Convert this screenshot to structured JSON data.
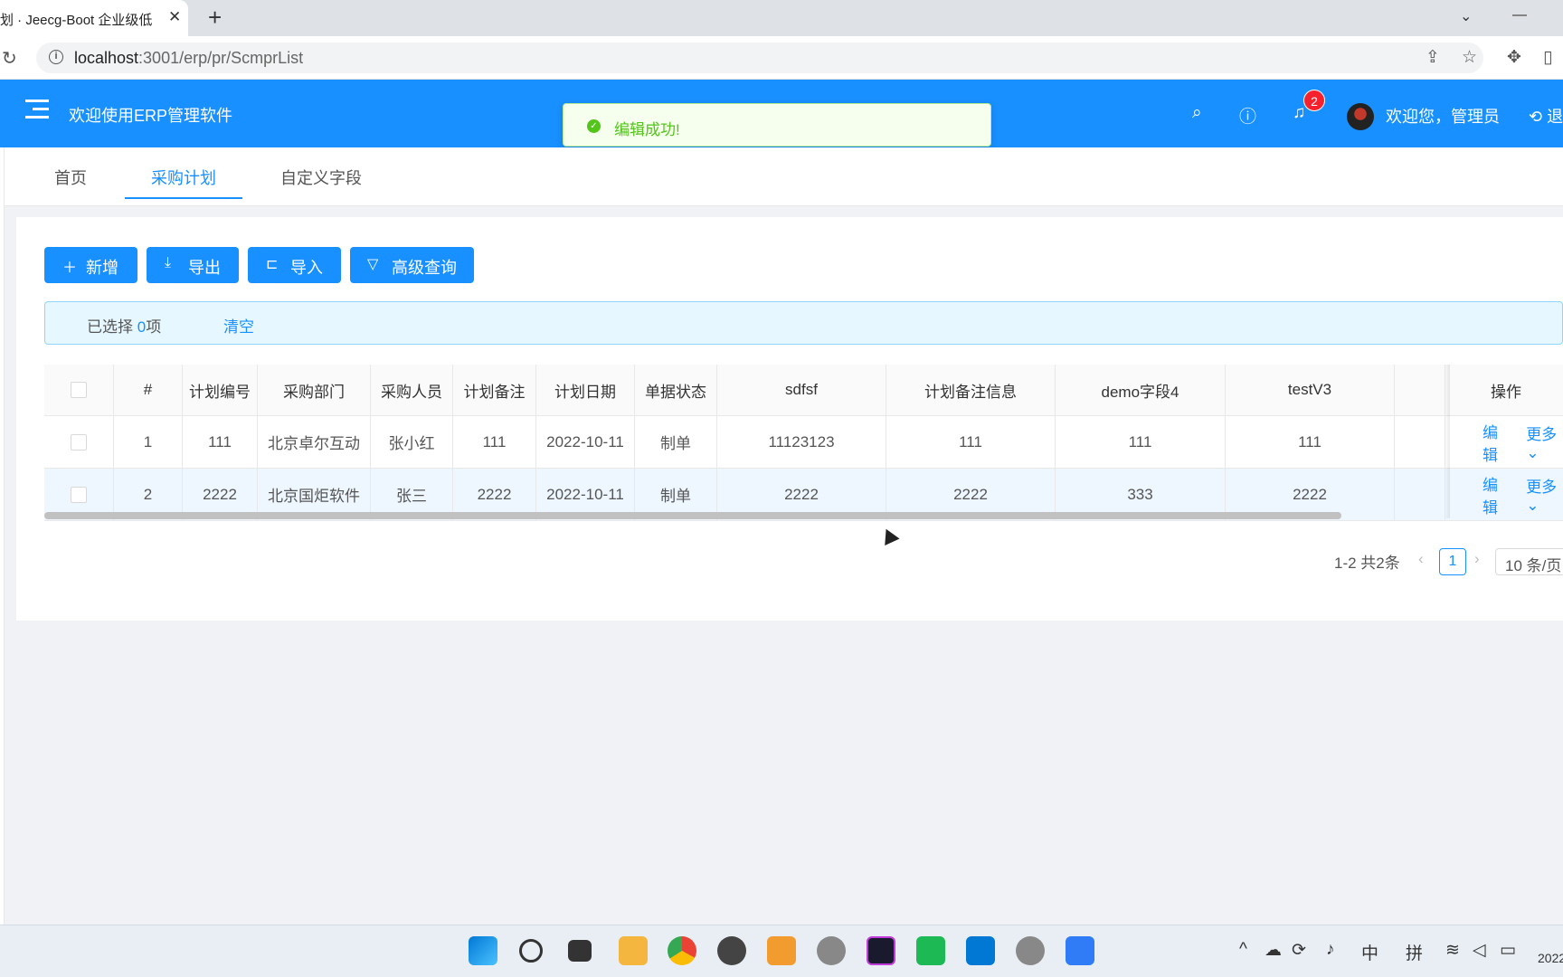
{
  "browser": {
    "tab_title": "划 · Jeecg-Boot 企业级低",
    "url_host": "localhost",
    "url_rest": ":3001/erp/pr/ScmprList"
  },
  "header": {
    "app_title": "欢迎使用ERP管理软件",
    "notification_count": "2",
    "greeting": "欢迎您，管理员",
    "logout": "退"
  },
  "toast": {
    "message": "编辑成功!",
    "color": "#52c41a"
  },
  "page_tabs": [
    {
      "label": "首页"
    },
    {
      "label": "采购计划"
    },
    {
      "label": "自定义字段"
    }
  ],
  "toolbar": {
    "add_label": "新增",
    "export_label": "导出",
    "import_label": "导入",
    "advanced_query_label": "高级查询"
  },
  "selection": {
    "prefix": "已选择 ",
    "count": "0",
    "suffix": "项",
    "clear": "清空"
  },
  "table": {
    "columns": [
      "#",
      "计划编号",
      "采购部门",
      "采购人员",
      "计划备注",
      "计划日期",
      "单据状态",
      "sdfsf",
      "计划备注信息",
      "demo字段4",
      "testV3",
      "操作"
    ],
    "rows": [
      {
        "index": "1",
        "plan_no": "111",
        "dept": "北京卓尔互动",
        "buyer": "张小红",
        "remark": "111",
        "date": "2022-10-11",
        "status": "制单",
        "sdfsf": "11123123",
        "remark_info": "111",
        "demo4": "111",
        "testv3": "111",
        "edit": "编辑",
        "more": "更多"
      },
      {
        "index": "2",
        "plan_no": "2222",
        "dept": "北京国炬软件",
        "buyer": "张三",
        "remark": "2222",
        "date": "2022-10-11",
        "status": "制单",
        "sdfsf": "2222",
        "remark_info": "2222",
        "demo4": "333",
        "testv3": "2222",
        "edit": "编辑",
        "more": "更多"
      }
    ]
  },
  "pagination": {
    "summary": "1-2 共2条",
    "current_page": "1",
    "page_size": "10 条/页"
  },
  "taskbar": {
    "ime_lang": "中",
    "ime_mode": "拼",
    "clock": "2022"
  },
  "colors": {
    "primary": "#1890ff",
    "success": "#52c41a",
    "badge": "#f5222d"
  }
}
